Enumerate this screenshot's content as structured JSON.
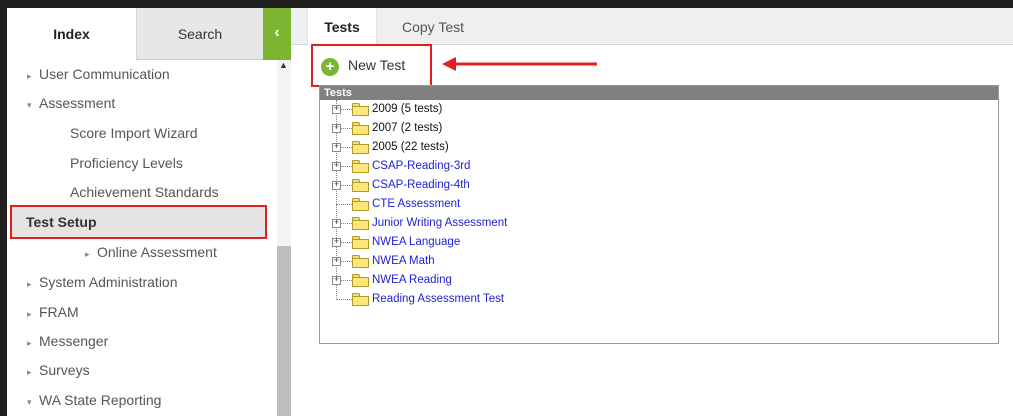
{
  "sidebar": {
    "tabs": {
      "index": "Index",
      "search": "Search",
      "collapse": "‹"
    },
    "items": [
      {
        "label": "User Communication",
        "marker": "▸"
      },
      {
        "label": "Assessment",
        "marker": "▾"
      },
      {
        "label": "Score Import Wizard"
      },
      {
        "label": "Proficiency Levels"
      },
      {
        "label": "Achievement Standards"
      },
      {
        "label": "Test Setup"
      },
      {
        "label": "Online Assessment",
        "marker": "▸"
      },
      {
        "label": "System Administration",
        "marker": "▸"
      },
      {
        "label": "FRAM",
        "marker": "▸"
      },
      {
        "label": "Messenger",
        "marker": "▸"
      },
      {
        "label": "Surveys",
        "marker": "▸"
      },
      {
        "label": "WA State Reporting",
        "marker": "▾"
      }
    ]
  },
  "main": {
    "tabs": [
      {
        "label": "Tests"
      },
      {
        "label": "Copy Test"
      }
    ],
    "new_test": {
      "icon": "plus-icon",
      "label": "New Test"
    },
    "tree": {
      "header": "Tests",
      "rows": [
        {
          "label": "2009 (5 tests)",
          "expandable": true,
          "style": "black"
        },
        {
          "label": "2007 (2 tests)",
          "expandable": true,
          "style": "black"
        },
        {
          "label": "2005 (22 tests)",
          "expandable": true,
          "style": "black"
        },
        {
          "label": "CSAP-Reading-3rd",
          "expandable": true,
          "style": "blue"
        },
        {
          "label": "CSAP-Reading-4th",
          "expandable": true,
          "style": "blue"
        },
        {
          "label": "CTE Assessment",
          "expandable": false,
          "style": "blue"
        },
        {
          "label": "Junior Writing Assessment",
          "expandable": true,
          "style": "blue"
        },
        {
          "label": "NWEA Language",
          "expandable": true,
          "style": "blue"
        },
        {
          "label": "NWEA Math",
          "expandable": true,
          "style": "blue"
        },
        {
          "label": "NWEA Reading",
          "expandable": true,
          "style": "blue"
        },
        {
          "label": "Reading Assessment Test",
          "expandable": false,
          "style": "blue"
        }
      ]
    }
  },
  "colors": {
    "accent_green": "#7cb52f",
    "annotation_red": "#e02020",
    "link_blue": "#2121d8",
    "folder_yellow": "#fde77a"
  }
}
